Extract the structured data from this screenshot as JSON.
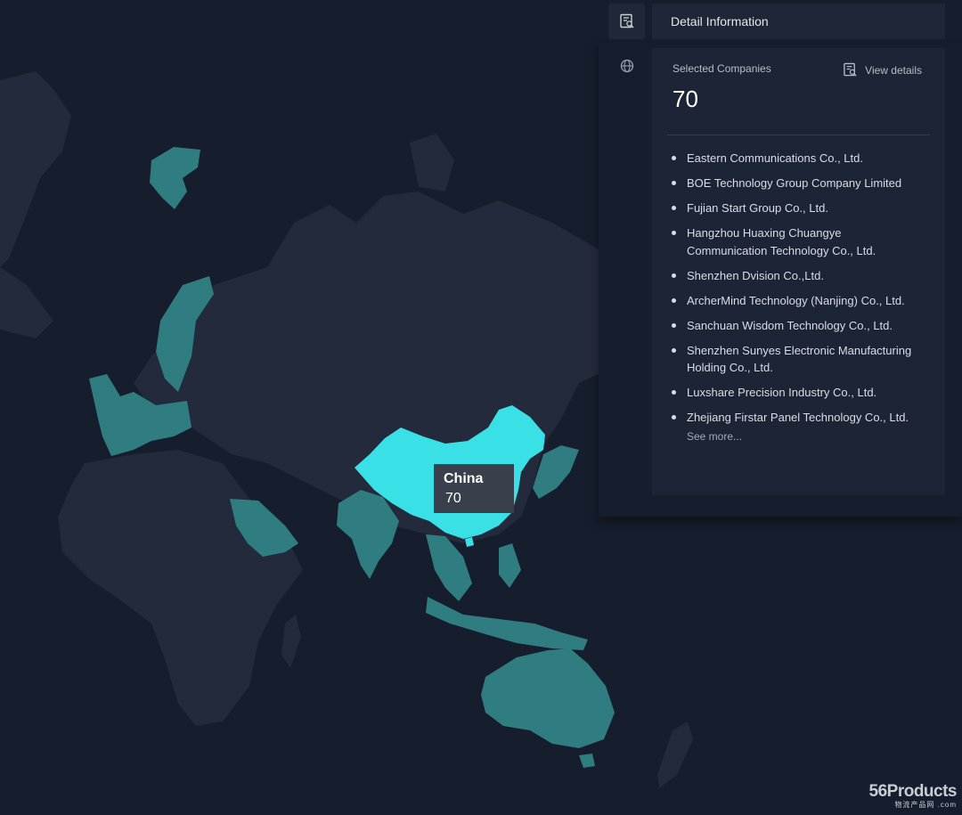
{
  "map": {
    "selected_country": "China",
    "tooltip": {
      "country": "China",
      "value": "70"
    },
    "highlighted_regions": [
      "Greenland",
      "Europe",
      "Arabian Peninsula",
      "India",
      "Japan",
      "Southeast Asia",
      "Australia"
    ]
  },
  "sidebar": {
    "items": [
      {
        "icon": "report-search-icon",
        "active": true
      },
      {
        "icon": "globe-icon",
        "active": false
      }
    ]
  },
  "panel": {
    "title": "Detail Information",
    "selected_label": "Selected Companies",
    "selected_count": "70",
    "view_details": "View details",
    "companies": [
      "Eastern Communications Co., Ltd.",
      "BOE Technology Group Company Limited",
      "Fujian Start Group Co., Ltd.",
      "Hangzhou Huaxing Chuangye Communication Technology Co., Ltd.",
      "Shenzhen Dvision Co.,Ltd.",
      "ArcherMind Technology (Nanjing) Co., Ltd.",
      "Sanchuan Wisdom Technology Co., Ltd.",
      "Shenzhen Sunyes Electronic Manufacturing Holding Co., Ltd.",
      "Luxshare Precision Industry Co., Ltd.",
      "Zhejiang Firstar Panel Technology Co., Ltd."
    ],
    "see_more": "See more..."
  },
  "watermark": {
    "main": "56Products",
    "sub": "物流产品网 .com"
  },
  "colors": {
    "background": "#161d2c",
    "land": "#232a3b",
    "highlight": "#2f7d80",
    "selected": "#39e1e6",
    "panel": "#1d2435"
  }
}
